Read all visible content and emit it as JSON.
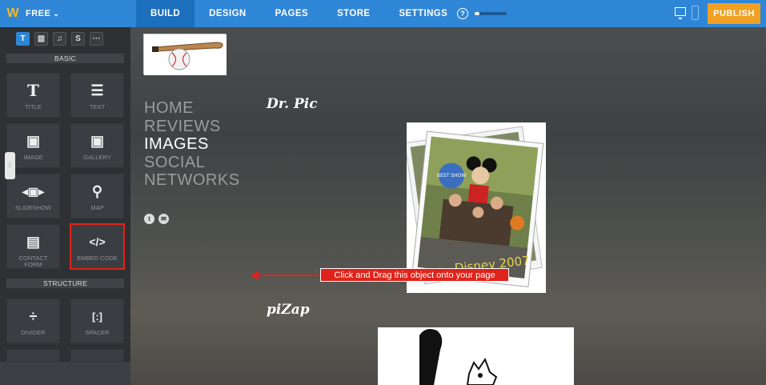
{
  "topbar": {
    "logo": "W",
    "plan": "FREE",
    "tabs": [
      "BUILD",
      "DESIGN",
      "PAGES",
      "STORE",
      "SETTINGS"
    ],
    "active_tab": "BUILD",
    "help": "?",
    "setup_progress": 0.15,
    "publish": "PUBLISH"
  },
  "sidebar": {
    "category_tabs": [
      {
        "icon": "text-icon",
        "glyph": "T"
      },
      {
        "icon": "layout-icon",
        "glyph": "▥"
      },
      {
        "icon": "music-icon",
        "glyph": "♫"
      },
      {
        "icon": "store-icon",
        "glyph": "S"
      },
      {
        "icon": "more-icon",
        "glyph": "···"
      }
    ],
    "sections": {
      "basic": "BASIC",
      "structure": "STRUCTURE"
    },
    "basic_items": [
      {
        "label": "TITLE",
        "icon": "title-icon",
        "glyph": "T"
      },
      {
        "label": "TEXT",
        "icon": "text-lines-icon",
        "glyph": "☰"
      },
      {
        "label": "IMAGE",
        "icon": "image-icon",
        "glyph": "▣"
      },
      {
        "label": "GALLERY",
        "icon": "gallery-icon",
        "glyph": "▣"
      },
      {
        "label": "SLIDESHOW",
        "icon": "slideshow-icon",
        "glyph": "◂▣▸"
      },
      {
        "label": "MAP",
        "icon": "map-pin-icon",
        "glyph": "⚲"
      },
      {
        "label": "CONTACT FORM",
        "icon": "form-icon",
        "glyph": "▤"
      },
      {
        "label": "EMBED CODE",
        "icon": "code-icon",
        "glyph": "</>"
      }
    ],
    "structure_items": [
      {
        "label": "DIVIDER",
        "icon": "divider-icon",
        "glyph": "÷"
      },
      {
        "label": "SPACER",
        "icon": "spacer-icon",
        "glyph": "[:]"
      }
    ]
  },
  "site": {
    "menu": [
      "HOME",
      "REVIEWS",
      "IMAGES",
      "SOCIAL",
      "NETWORKS"
    ],
    "active_menu": "IMAGES",
    "headings": [
      "Dr. Pic",
      "piZap"
    ],
    "photo_caption": "Disney 2007",
    "photo_sign": "BEST SHOW"
  },
  "callout": {
    "text": "Click and Drag this object onto your page",
    "color": "#e0231a"
  },
  "colors": {
    "topbar": "#2f86d6",
    "active_tab": "#1c6fbd",
    "publish": "#f0a022",
    "sidebar": "#2e3033"
  }
}
